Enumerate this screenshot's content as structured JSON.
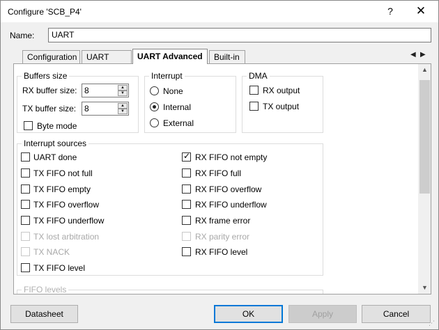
{
  "window": {
    "title": "Configure 'SCB_P4'",
    "help_label": "?",
    "close_label": "✕"
  },
  "name": {
    "label": "Name:",
    "value": "UART"
  },
  "tabs": [
    {
      "label": "Configuration"
    },
    {
      "label": "UART Basic"
    },
    {
      "label": "UART Advanced",
      "active": true
    },
    {
      "label": "Built-in"
    }
  ],
  "tab_nav": {
    "prev": "◀",
    "next": "▶"
  },
  "buffers": {
    "title": "Buffers size",
    "rx_label": "RX buffer size:",
    "rx_value": "8",
    "tx_label": "TX buffer size:",
    "tx_value": "8",
    "byte_mode_label": "Byte mode",
    "byte_mode_checked": false
  },
  "interrupt": {
    "title": "Interrupt",
    "options": [
      "None",
      "Internal",
      "External"
    ],
    "selected": "Internal"
  },
  "dma": {
    "title": "DMA",
    "rx_label": "RX output",
    "tx_label": "TX output"
  },
  "interrupt_sources": {
    "title": "Interrupt sources",
    "left": [
      {
        "label": "UART done",
        "checked": false,
        "disabled": false
      },
      {
        "label": "TX FIFO not full",
        "checked": false,
        "disabled": false
      },
      {
        "label": "TX FIFO empty",
        "checked": false,
        "disabled": false
      },
      {
        "label": "TX FIFO overflow",
        "checked": false,
        "disabled": false
      },
      {
        "label": "TX FIFO underflow",
        "checked": false,
        "disabled": false
      },
      {
        "label": "TX lost arbitration",
        "checked": false,
        "disabled": true
      },
      {
        "label": "TX NACK",
        "checked": false,
        "disabled": true
      },
      {
        "label": "TX FIFO level",
        "checked": false,
        "disabled": false
      }
    ],
    "right": [
      {
        "label": "RX FIFO not empty",
        "checked": true,
        "disabled": false
      },
      {
        "label": "RX FIFO full",
        "checked": false,
        "disabled": false
      },
      {
        "label": "RX FIFO overflow",
        "checked": false,
        "disabled": false
      },
      {
        "label": "RX FIFO underflow",
        "checked": false,
        "disabled": false
      },
      {
        "label": "RX frame error",
        "checked": false,
        "disabled": false
      },
      {
        "label": "RX parity error",
        "checked": false,
        "disabled": true
      },
      {
        "label": "RX FIFO level",
        "checked": false,
        "disabled": false
      }
    ]
  },
  "fifo_levels": {
    "title": "FIFO levels"
  },
  "buttons": {
    "datasheet": "Datasheet",
    "ok": "OK",
    "apply": "Apply",
    "cancel": "Cancel"
  },
  "scrollbar": {
    "up": "▲",
    "down": "▼"
  },
  "check_glyph": "✓",
  "resize_grip": "⋰"
}
